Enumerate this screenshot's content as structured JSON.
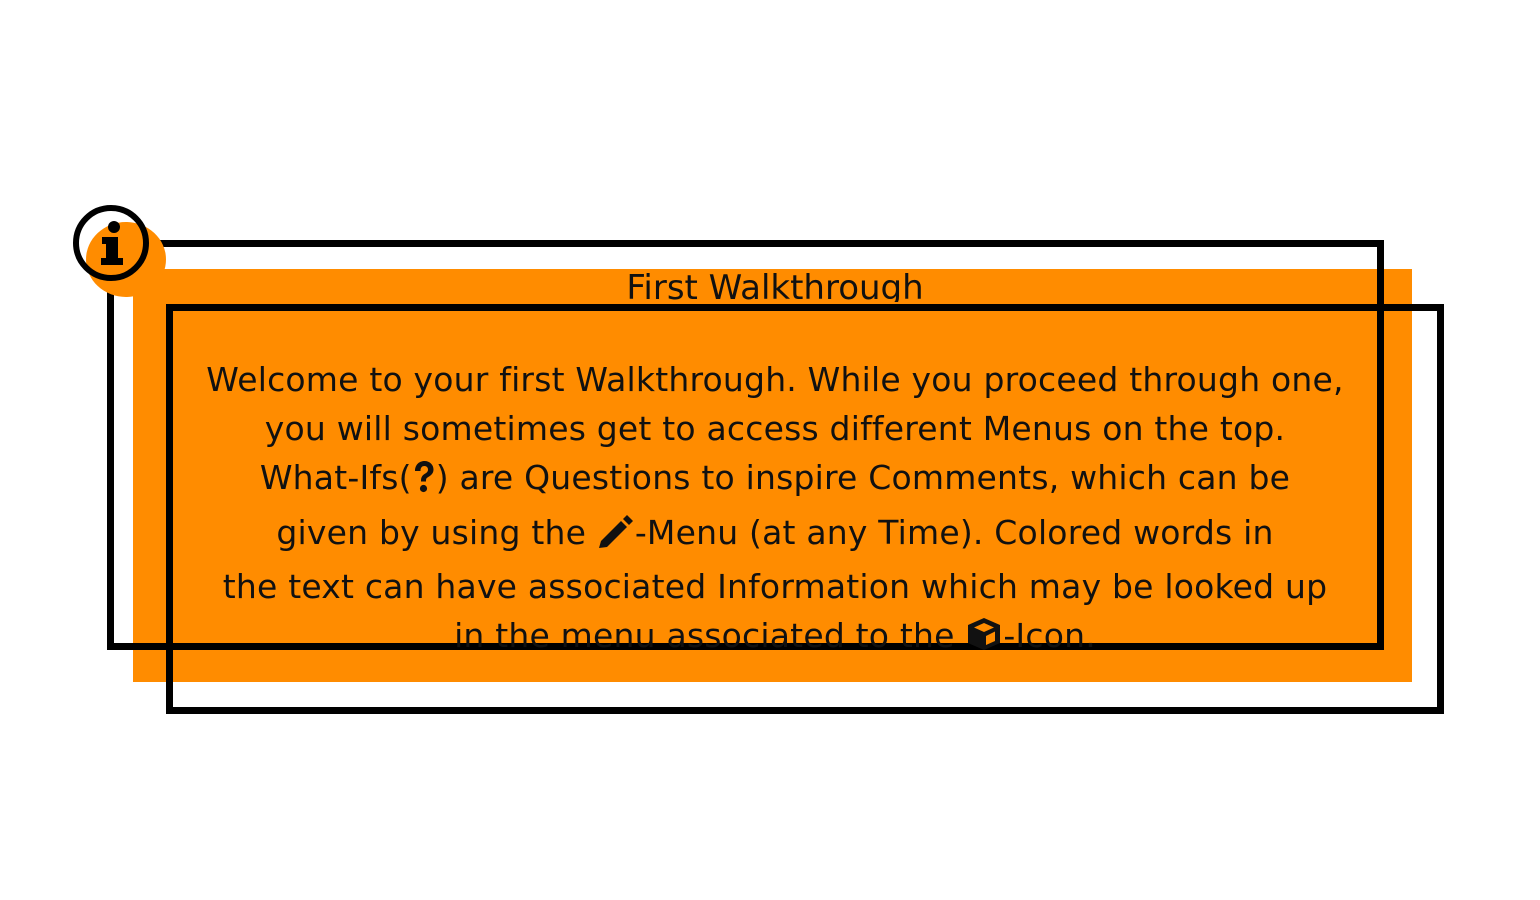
{
  "dialog": {
    "title": "First Walkthrough",
    "body": {
      "line1": "Welcome to your first Walkthrough. While you proceed through one,",
      "line2": "you will sometimes get to access different Menus on the top.",
      "line3_before": "What-Ifs(",
      "line3_after": ")  are Questions to inspire Comments, which can be",
      "line4_before": "given by using the ",
      "line4_after": "-Menu (at any Time). Colored words in",
      "line5": "the text can have associated Information which may be looked up",
      "line6_before": "in the menu associated to the ",
      "line6_after": "-Icon."
    }
  },
  "icons": {
    "badge": "info-icon",
    "what_if": "question-icon",
    "comment_menu": "pencil-icon",
    "information": "cube-icon"
  },
  "colors": {
    "accent": "#ff8c00",
    "frame": "#000000",
    "text": "#111111",
    "background": "#ffffff"
  }
}
